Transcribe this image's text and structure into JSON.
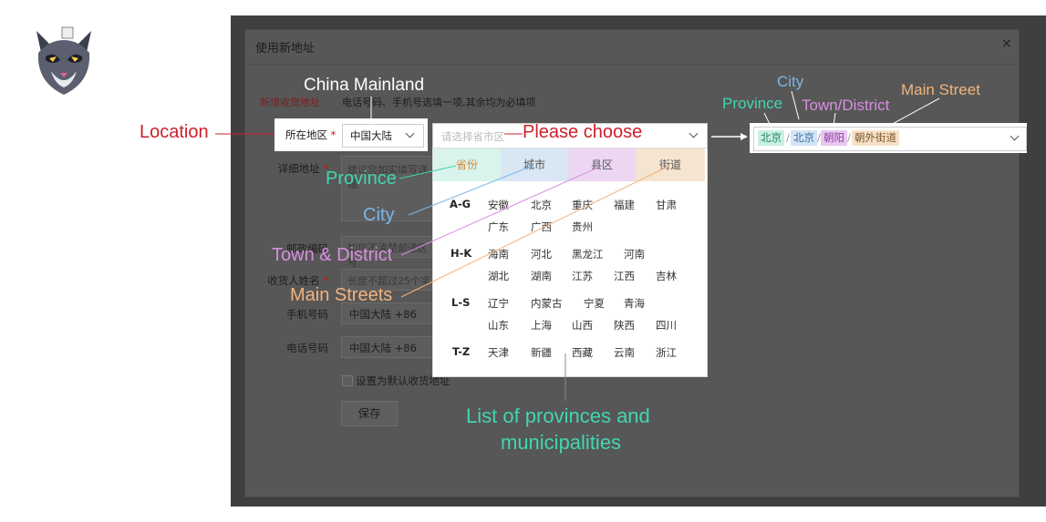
{
  "modal": {
    "title": "使用新地址",
    "close": "×",
    "section_hint_red": "新增收货地址",
    "section_hint": "电话号码、手机号选填一项,其余均为必填项",
    "location_label": "所在地区",
    "required_mark": "*",
    "region_value": "中国大陆",
    "address_label": "详细地址",
    "address_placeholder": "建议您如实填写详细",
    "postcode_label": "邮政编码",
    "postcode_placeholder": "如您不清楚邮递区号",
    "name_label": "收货人姓名",
    "name_placeholder": "长度不超过25个字",
    "mobile_label": "手机号码",
    "mobile_code": "中国大陆 +86",
    "phone_label": "电话号码",
    "phone_code": "中国大陆 +86",
    "default_checkbox": "设置为默认收货地址",
    "save": "保存"
  },
  "picker": {
    "placeholder": "请选择省市区",
    "tabs": [
      "省份",
      "城市",
      "县区",
      "街道"
    ],
    "groups": [
      {
        "key": "A-G",
        "rows": [
          [
            "安徽",
            "北京",
            "重庆",
            "福建",
            "甘肃"
          ],
          [
            "广东",
            "广西",
            "贵州"
          ]
        ]
      },
      {
        "key": "H-K",
        "rows": [
          [
            "海南",
            "河北",
            "黑龙江",
            "河南"
          ],
          [
            "湖北",
            "湖南",
            "江苏",
            "江西",
            "吉林"
          ]
        ]
      },
      {
        "key": "L-S",
        "rows": [
          [
            "辽宁",
            "内蒙古",
            "宁夏",
            "青海"
          ],
          [
            "山东",
            "上海",
            "山西",
            "陕西",
            "四川"
          ]
        ]
      },
      {
        "key": "T-Z",
        "rows": [
          [
            "天津",
            "新疆",
            "西藏",
            "云南",
            "浙江"
          ]
        ]
      }
    ]
  },
  "result": {
    "province": "北京",
    "city": "北京",
    "district": "朝阳",
    "street": "朝外街道",
    "sep": "/"
  },
  "annotations": {
    "china_mainland": "China Mainland",
    "location": "Location",
    "please_choose": "Please choose",
    "province": "Province",
    "city": "City",
    "town_district": "Town & District",
    "main_streets": "Main Streets",
    "list_line1": "List of provinces and",
    "list_line2": "municipalities",
    "r_city": "City",
    "r_province": "Province",
    "r_town": "Town/District",
    "r_main_street": "Main Street"
  },
  "colors": {
    "province": "#41d6b0",
    "city": "#7cb6e6",
    "district": "#d88fe0",
    "street": "#f2b37c",
    "location": "#cc1f2a",
    "tab_province": "#d8f4ec",
    "tab_city": "#d9e6f4",
    "tab_district": "#ecd7f2",
    "tab_street": "#f5e4cf"
  },
  "icons": {
    "logo": "cat-mask-logo",
    "drag": "grid-handle-icon"
  }
}
